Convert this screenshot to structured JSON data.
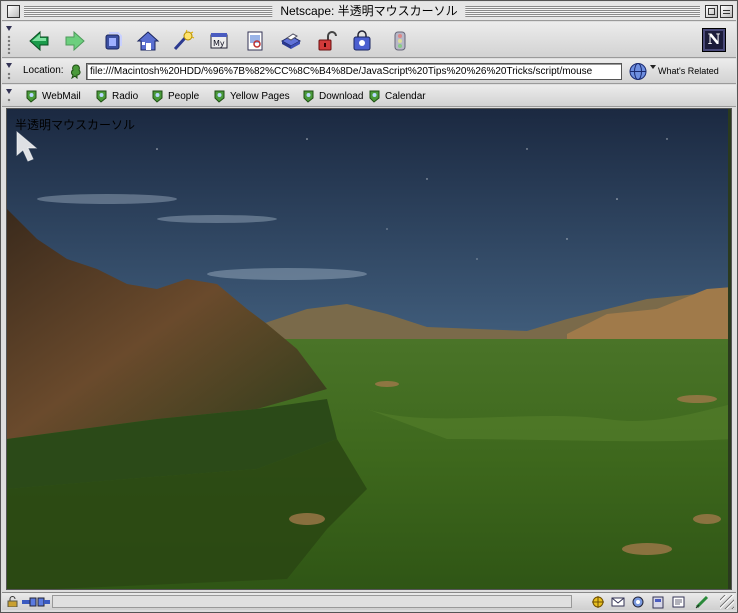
{
  "window": {
    "title": "Netscape: 半透明マウスカーソル"
  },
  "toolbar": {
    "buttons": [
      {
        "name": "back",
        "icon": "back-arrow-icon"
      },
      {
        "name": "forward",
        "icon": "forward-arrow-icon"
      },
      {
        "name": "reload",
        "icon": "reload-icon"
      },
      {
        "name": "home",
        "icon": "home-icon"
      },
      {
        "name": "search",
        "icon": "search-icon"
      },
      {
        "name": "my-netscape",
        "icon": "my-netscape-icon"
      },
      {
        "name": "images",
        "icon": "images-icon"
      },
      {
        "name": "print",
        "icon": "print-icon"
      },
      {
        "name": "security",
        "icon": "security-lock-icon"
      },
      {
        "name": "shop",
        "icon": "shop-bag-icon"
      },
      {
        "name": "stop",
        "icon": "stop-icon"
      }
    ],
    "logo": "N"
  },
  "location": {
    "label": "Location:",
    "url": "file:///Macintosh%20HDD/%96%7B%82%CC%8C%B4%8De/JavaScript%20Tips%20%26%20Tricks/script/mouse",
    "related_label": "What's Related"
  },
  "personal_toolbar": {
    "items": [
      "WebMail",
      "Radio",
      "People",
      "Yellow Pages",
      "Download",
      "Calendar"
    ]
  },
  "page": {
    "text": "半透明マウスカーソル"
  },
  "status": {
    "text": ""
  },
  "colors": {
    "window_bg": "#dedede",
    "sky_top": "#1d2c46",
    "sky_horizon": "#6e8aa0",
    "ground": "#3f6a1f"
  }
}
